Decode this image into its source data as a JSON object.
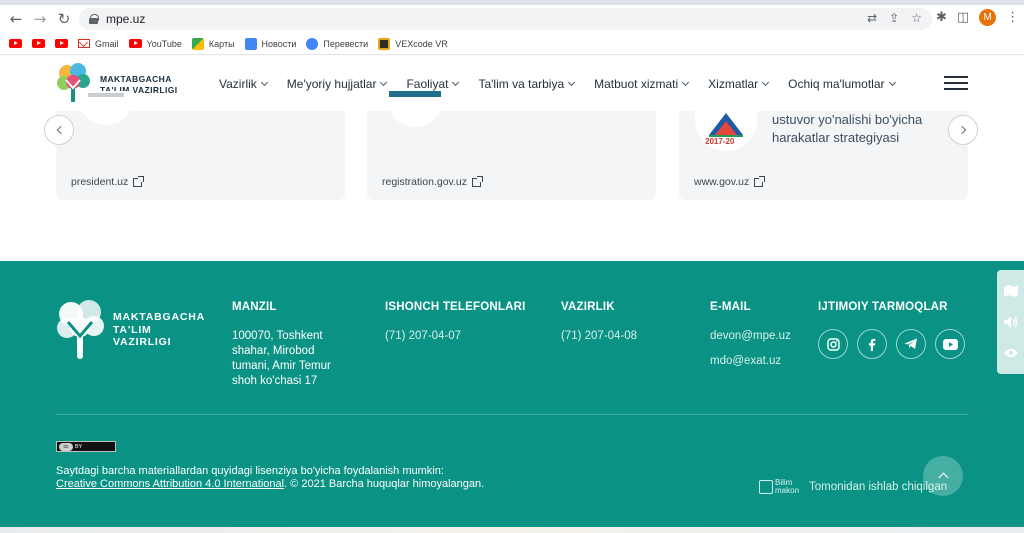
{
  "browser": {
    "url": "mpe.uz",
    "profile_initial": "M",
    "bookmarks": [
      {
        "label": "",
        "icon": "youtube-icon"
      },
      {
        "label": "",
        "icon": "youtube-icon"
      },
      {
        "label": "",
        "icon": "youtube-icon"
      },
      {
        "label": "Gmail",
        "icon": "gmail-icon"
      },
      {
        "label": "YouTube",
        "icon": "youtube-icon"
      },
      {
        "label": "Карты",
        "icon": "maps-icon"
      },
      {
        "label": "Новости",
        "icon": "news-icon"
      },
      {
        "label": "Перевести",
        "icon": "translate-icon"
      },
      {
        "label": "VEXcode VR",
        "icon": "vexcode-icon"
      }
    ]
  },
  "header": {
    "logo_line1": "MAKTABGACHA",
    "logo_line2": "TA'LIM VAZIRLIGI",
    "menu": [
      "Vazirlik",
      "Me'yoriy hujjatlar",
      "Faoliyat",
      "Ta'lim va tarbiya",
      "Matbuot xizmati",
      "Xizmatlar",
      "Ochiq ma'lumotlar"
    ]
  },
  "cards": [
    {
      "link": "president.uz"
    },
    {
      "link": "registration.gov.uz"
    },
    {
      "link": "www.gov.uz",
      "title_line1": "ustuvor yo'nalishi bo'yicha",
      "title_line2": "harakatlar strategiyasi",
      "badge_year": "2017-20"
    }
  ],
  "footer": {
    "logo_line1": "MAKTABGACHA",
    "logo_line2": "TA'LIM",
    "logo_line3": "VAZIRLIGI",
    "address": {
      "title": "MANZIL",
      "lines": [
        "100070, Toshkent",
        "shahar, Mirobod",
        "tumani, Amir Temur",
        "shoh ko'chasi 17"
      ]
    },
    "hotline": {
      "title": "ISHONCH TELEFONLARI",
      "phone": "(71) 207-04-07"
    },
    "ministry": {
      "title": "VAZIRLIK",
      "phone": "(71) 207-04-08"
    },
    "email": {
      "title": "E-MAIL",
      "items": [
        "devon@mpe.uz",
        "mdo@exat.uz"
      ]
    },
    "social": {
      "title": "IJTIMOIY TARMOQLAR",
      "icons": [
        "instagram-icon",
        "facebook-icon",
        "telegram-icon",
        "youtube-icon"
      ]
    },
    "cc_badge": "BY",
    "license_text": "Saytdagi barcha materiallardan quyidagi lisenziya bo'yicha foydalanish mumkin:",
    "license_link": "Creative Commons Attribution 4.0 International",
    "copyright": ". © 2021 Barcha huquqlar himoyalangan.",
    "developer_logo_line1": "Bilim",
    "developer_logo_line2": "makon",
    "developer_text": "Tomonidan ishlab chiqilgan"
  },
  "colors": {
    "footer_bg": "#0a9385",
    "card_bg": "#f4f5f6",
    "accent": "#e8710a"
  }
}
